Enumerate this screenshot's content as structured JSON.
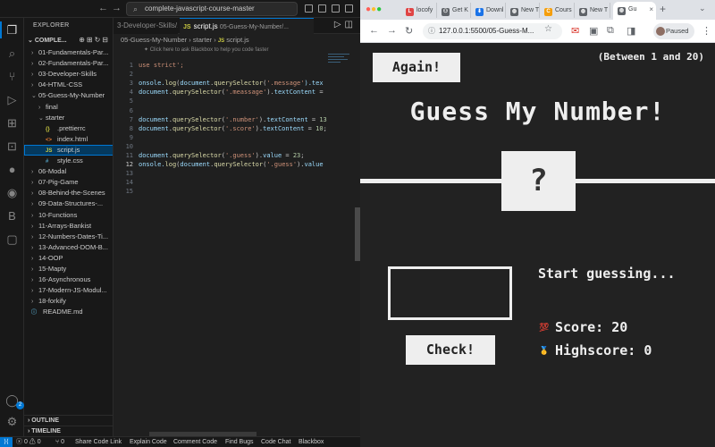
{
  "vscode": {
    "search_text": "complete-javascript-course-master",
    "explorer_label": "EXPLORER",
    "project_label": "COMPLE...",
    "tree": [
      {
        "label": "01-Fundamentals-Par...",
        "type": "folder",
        "depth": 0
      },
      {
        "label": "02-Fundamentals-Par...",
        "type": "folder",
        "depth": 0
      },
      {
        "label": "03-Developer-Skills",
        "type": "folder",
        "depth": 0
      },
      {
        "label": "04-HTML-CSS",
        "type": "folder",
        "depth": 0
      },
      {
        "label": "05-Guess-My-Number",
        "type": "folder-open",
        "depth": 0
      },
      {
        "label": "final",
        "type": "folder",
        "depth": 1
      },
      {
        "label": "starter",
        "type": "folder-open",
        "depth": 1
      },
      {
        "label": ".prettierrc",
        "type": "json",
        "depth": 2
      },
      {
        "label": "index.html",
        "type": "html",
        "depth": 2
      },
      {
        "label": "script.js",
        "type": "js",
        "depth": 2,
        "selected": true
      },
      {
        "label": "style.css",
        "type": "css",
        "depth": 2
      },
      {
        "label": "06-Modal",
        "type": "folder",
        "depth": 0
      },
      {
        "label": "07-Pig-Game",
        "type": "folder",
        "depth": 0
      },
      {
        "label": "08-Behind-the-Scenes",
        "type": "folder",
        "depth": 0
      },
      {
        "label": "09-Data-Structures-...",
        "type": "folder",
        "depth": 0
      },
      {
        "label": "10-Functions",
        "type": "folder",
        "depth": 0
      },
      {
        "label": "11-Arrays-Bankist",
        "type": "folder",
        "depth": 0
      },
      {
        "label": "12-Numbers-Dates-Ti...",
        "type": "folder",
        "depth": 0
      },
      {
        "label": "13-Advanced-DOM-B...",
        "type": "folder",
        "depth": 0
      },
      {
        "label": "14-OOP",
        "type": "folder",
        "depth": 0
      },
      {
        "label": "15-Mapty",
        "type": "folder",
        "depth": 0
      },
      {
        "label": "16-Asynchronous",
        "type": "folder",
        "depth": 0
      },
      {
        "label": "17-Modern-JS-Modul...",
        "type": "folder",
        "depth": 0
      },
      {
        "label": "18-forkify",
        "type": "folder",
        "depth": 0
      },
      {
        "label": "README.md",
        "type": "md",
        "depth": 0
      }
    ],
    "outline_label": "OUTLINE",
    "timeline_label": "TIMELINE",
    "tabs": [
      {
        "label": "3-Developer-Skills/...",
        "active": false
      },
      {
        "label": "script.js",
        "detail": "05-Guess-My-Number/...",
        "active": true
      }
    ],
    "breadcrumb": [
      "05-Guess-My-Number",
      "starter",
      "script.js"
    ],
    "hint": "Click here to ask Blackbox to help you code faster",
    "code_lines": [
      [
        {
          "t": "use strict';",
          "c": "s"
        }
      ],
      [],
      [
        {
          "t": "onsole.",
          "c": "v"
        },
        {
          "t": "log",
          "c": "f"
        },
        {
          "t": "(",
          "c": "p"
        },
        {
          "t": "document",
          "c": "v"
        },
        {
          "t": ".",
          "c": "p"
        },
        {
          "t": "querySelector",
          "c": "f"
        },
        {
          "t": "(",
          "c": "p"
        },
        {
          "t": "'.message'",
          "c": "s"
        },
        {
          "t": ").tex",
          "c": "v"
        }
      ],
      [
        {
          "t": "document",
          "c": "v"
        },
        {
          "t": ".",
          "c": "p"
        },
        {
          "t": "querySelector",
          "c": "f"
        },
        {
          "t": "(",
          "c": "p"
        },
        {
          "t": "'.meassage'",
          "c": "s"
        },
        {
          "t": ").",
          "c": "p"
        },
        {
          "t": "textContent",
          "c": "v"
        },
        {
          "t": " = ",
          "c": "p"
        }
      ],
      [],
      [],
      [
        {
          "t": "document",
          "c": "v"
        },
        {
          "t": ".",
          "c": "p"
        },
        {
          "t": "querySelector",
          "c": "f"
        },
        {
          "t": "(",
          "c": "p"
        },
        {
          "t": "'.number'",
          "c": "s"
        },
        {
          "t": ").",
          "c": "p"
        },
        {
          "t": "textContent",
          "c": "v"
        },
        {
          "t": " = ",
          "c": "p"
        },
        {
          "t": "13",
          "c": "n"
        }
      ],
      [
        {
          "t": "document",
          "c": "v"
        },
        {
          "t": ".",
          "c": "p"
        },
        {
          "t": "querySelector",
          "c": "f"
        },
        {
          "t": "(",
          "c": "p"
        },
        {
          "t": "'.score'",
          "c": "s"
        },
        {
          "t": ").",
          "c": "p"
        },
        {
          "t": "textContent",
          "c": "v"
        },
        {
          "t": " = ",
          "c": "p"
        },
        {
          "t": "10",
          "c": "n"
        },
        {
          "t": ";",
          "c": "p"
        }
      ],
      [],
      [],
      [
        {
          "t": "document",
          "c": "v"
        },
        {
          "t": ".",
          "c": "p"
        },
        {
          "t": "querySelector",
          "c": "f"
        },
        {
          "t": "(",
          "c": "p"
        },
        {
          "t": "'.guess'",
          "c": "s"
        },
        {
          "t": ").",
          "c": "p"
        },
        {
          "t": "value",
          "c": "v"
        },
        {
          "t": " = ",
          "c": "p"
        },
        {
          "t": "23",
          "c": "n"
        },
        {
          "t": ";",
          "c": "p"
        }
      ],
      [
        {
          "t": "onsole.",
          "c": "v"
        },
        {
          "t": "log",
          "c": "f"
        },
        {
          "t": "(",
          "c": "p"
        },
        {
          "t": "document",
          "c": "v"
        },
        {
          "t": ".",
          "c": "p"
        },
        {
          "t": "querySelector",
          "c": "f"
        },
        {
          "t": "(",
          "c": "p"
        },
        {
          "t": "'.guess'",
          "c": "s"
        },
        {
          "t": ").",
          "c": "p"
        },
        {
          "t": "value",
          "c": "v"
        }
      ],
      [],
      [],
      []
    ],
    "line_numbers": [
      "1",
      "2",
      "3",
      "4",
      "5",
      "6",
      "7",
      "8",
      "9",
      "10",
      "11",
      "12",
      "13",
      "14",
      "15"
    ],
    "current_line": "12",
    "status": {
      "errors": "0",
      "warnings": "0",
      "ports": "0",
      "items": [
        "Share Code Link",
        "Explain Code",
        "Comment Code",
        "Find Bugs",
        "Code Chat",
        "Blackbox"
      ]
    },
    "account_badge": "2"
  },
  "chrome": {
    "tabs": [
      {
        "label": "locofy",
        "icon_color": "#e04545",
        "icon": "L"
      },
      {
        "label": "Get K",
        "icon_color": "#5f6368",
        "icon": "⚇"
      },
      {
        "label": "Downl",
        "icon_color": "#1a73e8",
        "icon": "⬇"
      },
      {
        "label": "New T",
        "icon_color": "#5f6368",
        "icon": "◍"
      },
      {
        "label": "Cours",
        "icon_color": "#f59e0b",
        "icon": "C"
      },
      {
        "label": "New T",
        "icon_color": "#5f6368",
        "icon": "◍"
      },
      {
        "label": "Gu",
        "icon_color": "#5f6368",
        "icon": "◍",
        "active": true
      }
    ],
    "url": "127.0.0.1:5500/05-Guess-M...",
    "profile_label": "Paused"
  },
  "game": {
    "again_label": "Again!",
    "between_label": "(Between 1 and 20)",
    "title": "Guess My Number!",
    "number_display": "?",
    "guess_value": "",
    "check_label": "Check!",
    "message": "Start guessing...",
    "score_label": "Score:",
    "score_value": "20",
    "score_icon": "💯",
    "highscore_label": "Highscore:",
    "highscore_value": "0",
    "highscore_icon": "🥇",
    "colors": {
      "background": "#222222",
      "foreground": "#eeeeee"
    }
  }
}
